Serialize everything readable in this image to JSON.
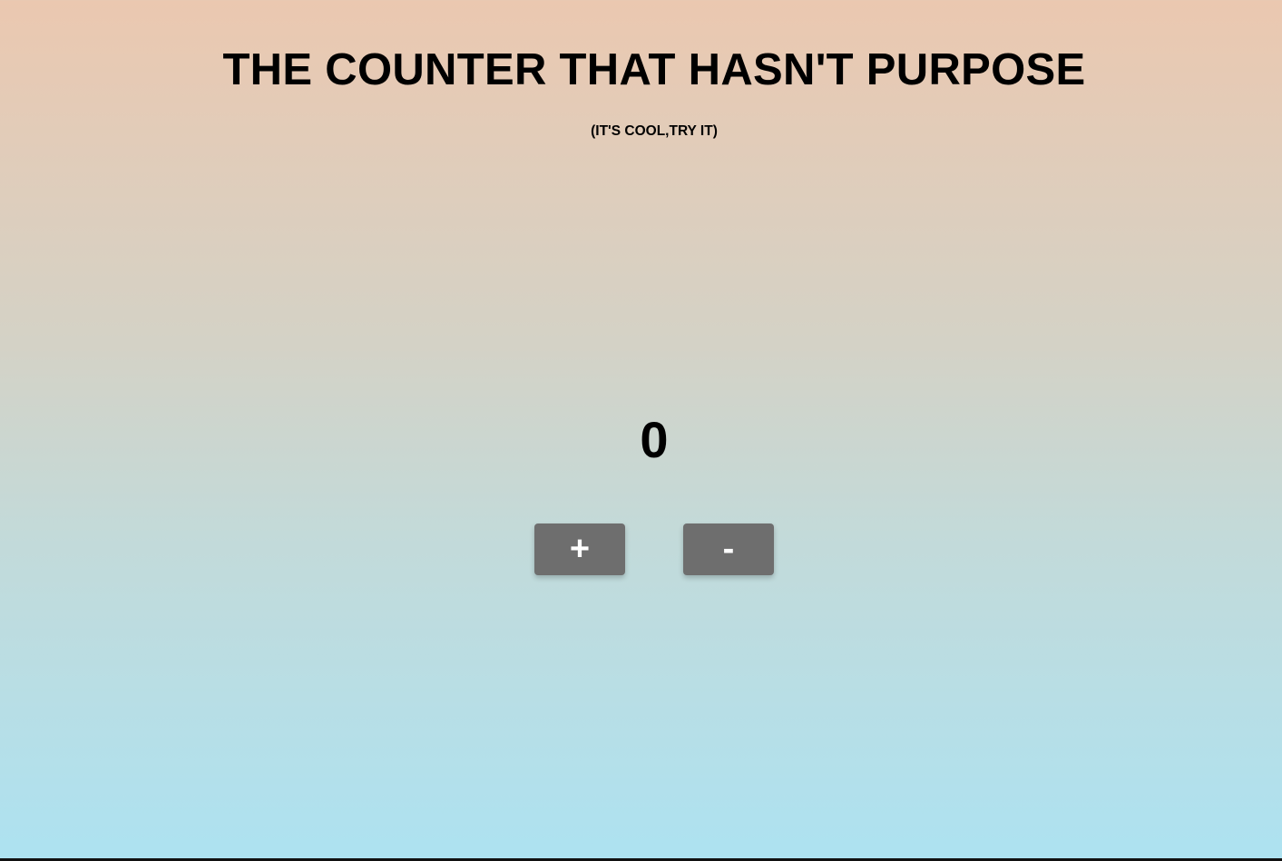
{
  "page": {
    "title": "THE COUNTER THAT HASN'T PURPOSE",
    "subtitle": "(IT'S COOL,TRY IT)"
  },
  "counter": {
    "value": "0",
    "increment_label": "+",
    "decrement_label": "-"
  },
  "colors": {
    "gradient_top": "#ebc8b0",
    "gradient_bottom": "#ade2f1",
    "button_background": "#6e6e6e",
    "button_text": "#ffffff"
  }
}
